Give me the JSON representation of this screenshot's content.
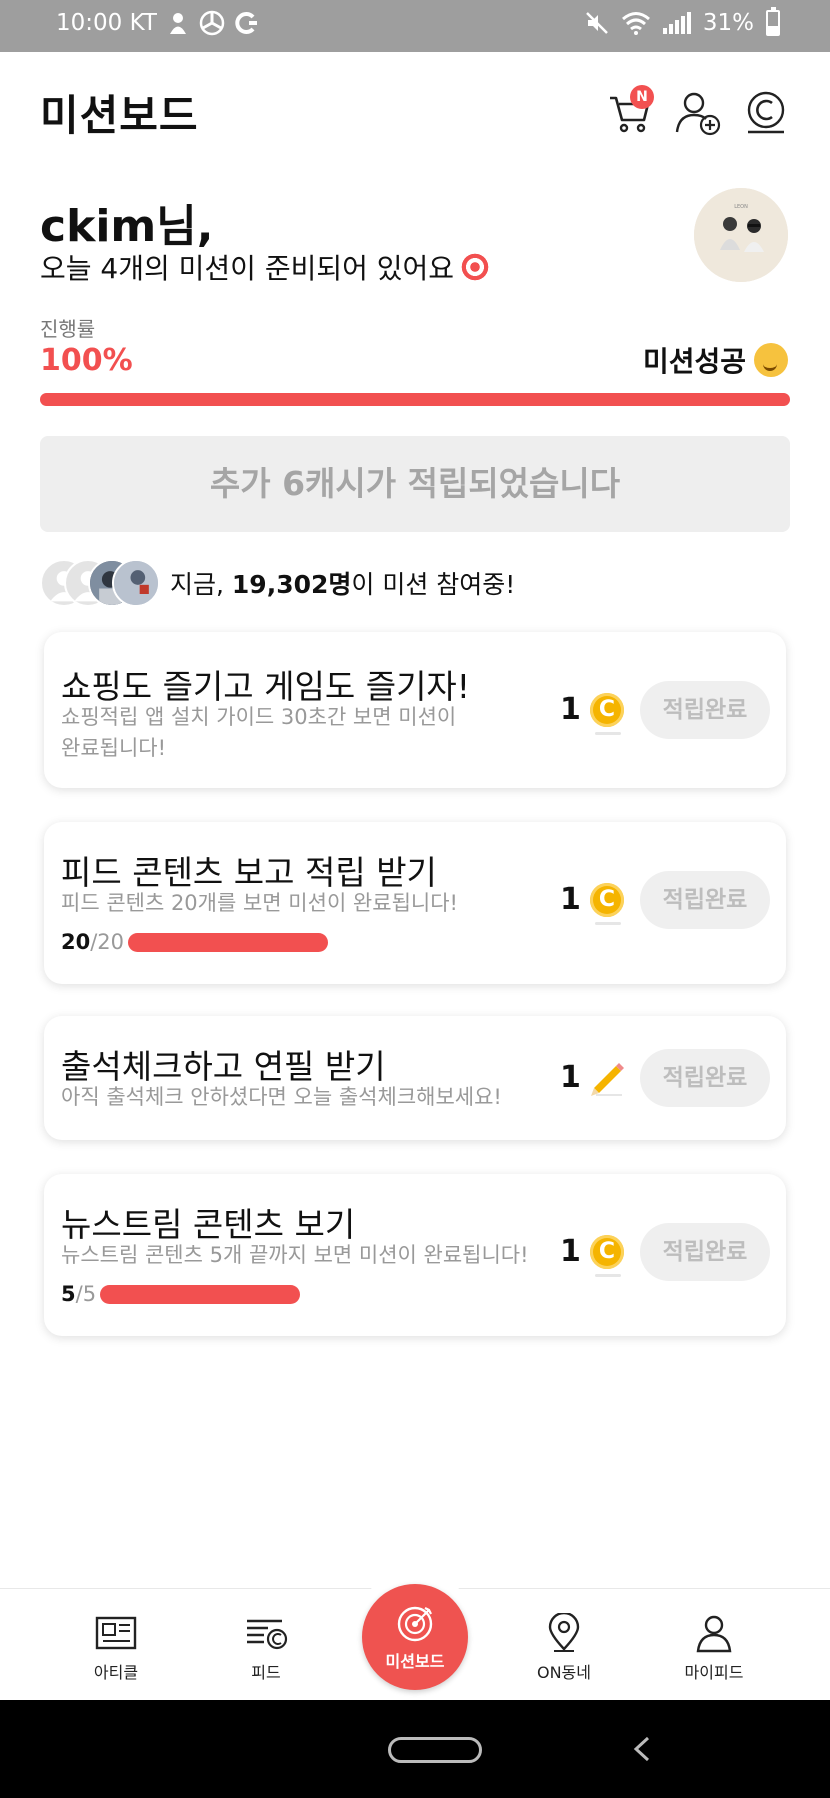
{
  "status_bar": {
    "time": "10:00 KT",
    "battery": "31%"
  },
  "header": {
    "title": "미션보드",
    "cart_badge": "N"
  },
  "greeting": {
    "name": "ckim님,",
    "subtitle": "오늘 4개의 미션이 준비되어 있어요"
  },
  "progress": {
    "label": "진행률",
    "value": "100%",
    "fraction": 1.0,
    "success_label": "미션성공"
  },
  "banner": {
    "text": "추가 6캐시가 적립되었습니다"
  },
  "participants": {
    "prefix": "지금, ",
    "count": "19,302명",
    "suffix": "이 미션 참여중!"
  },
  "missions": [
    {
      "title": "쇼핑도 즐기고 게임도 즐기자!",
      "desc": "쇼핑적립 앱 설치 가이드 30초간 보면 미션이 완료됩니다!",
      "reward": "1",
      "reward_icon": "coin-icon",
      "button": "적립완료"
    },
    {
      "title": "피드 콘텐츠 보고 적립 받기",
      "desc": "피드 콘텐츠 20개를 보면 미션이 완료됩니다!",
      "count_done": "20",
      "count_total": "/20",
      "progress": 1.0,
      "reward": "1",
      "reward_icon": "coin-icon",
      "button": "적립완료"
    },
    {
      "title": "출석체크하고 연필 받기",
      "desc": "아직 출석체크 안하셨다면 오늘 출석체크해보세요!",
      "reward": "1",
      "reward_icon": "pencil-icon",
      "button": "적립완료"
    },
    {
      "title": "뉴스트림 콘텐츠 보기",
      "desc": "뉴스트림 콘텐츠 5개 끝까지 보면 미션이 완료됩니다!",
      "count_done": "5",
      "count_total": "/5",
      "progress": 1.0,
      "reward": "1",
      "reward_icon": "coin-icon",
      "button": "적립완료"
    }
  ],
  "bottom_nav": [
    {
      "label": "아티클",
      "icon": "article-icon"
    },
    {
      "label": "피드",
      "icon": "feed-icon"
    },
    {
      "label": "미션보드",
      "icon": "target-icon",
      "active": true
    },
    {
      "label": "ON동네",
      "icon": "location-pin-icon"
    },
    {
      "label": "마이피드",
      "icon": "person-icon"
    }
  ],
  "colors": {
    "accent": "#f25050",
    "coin": "#f5b400",
    "muted": "#999999"
  }
}
